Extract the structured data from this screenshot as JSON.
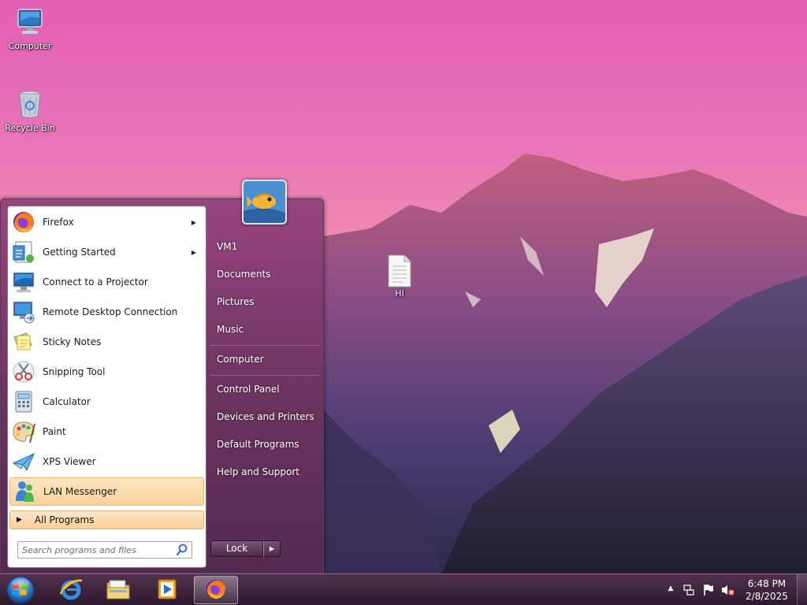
{
  "desktop": {
    "icons": [
      {
        "label": "Computer",
        "icon": "computer-icon"
      },
      {
        "label": "Recycle Bin",
        "icon": "recycle-bin-icon"
      },
      {
        "label": "HI",
        "icon": "text-file-icon"
      }
    ]
  },
  "start_menu": {
    "programs": [
      {
        "label": "Firefox",
        "icon": "firefox-icon",
        "has_submenu": true
      },
      {
        "label": "Getting Started",
        "icon": "getting-started-icon",
        "has_submenu": true
      },
      {
        "label": "Connect to a Projector",
        "icon": "projector-icon",
        "has_submenu": false
      },
      {
        "label": "Remote Desktop Connection",
        "icon": "remote-desktop-icon",
        "has_submenu": false
      },
      {
        "label": "Sticky Notes",
        "icon": "sticky-notes-icon",
        "has_submenu": false
      },
      {
        "label": "Snipping Tool",
        "icon": "scissors-icon",
        "has_submenu": false
      },
      {
        "label": "Calculator",
        "icon": "calculator-icon",
        "has_submenu": false
      },
      {
        "label": "Paint",
        "icon": "paint-palette-icon",
        "has_submenu": false
      },
      {
        "label": "XPS Viewer",
        "icon": "xps-viewer-icon",
        "has_submenu": false
      },
      {
        "label": "LAN Messenger",
        "icon": "lan-messenger-icon",
        "has_submenu": false,
        "highlighted": true
      }
    ],
    "all_programs_label": "All Programs",
    "search_placeholder": "Search programs and files",
    "places": [
      {
        "label": "VM1"
      },
      {
        "label": "Documents"
      },
      {
        "label": "Pictures"
      },
      {
        "label": "Music"
      },
      {
        "label": "Computer"
      },
      {
        "label": "Control Panel"
      },
      {
        "label": "Devices and Printers"
      },
      {
        "label": "Default Programs"
      },
      {
        "label": "Help and Support"
      }
    ],
    "lock_label": "Lock"
  },
  "taskbar": {
    "pinned": [
      {
        "icon": "internet-explorer-icon"
      },
      {
        "icon": "file-explorer-icon"
      },
      {
        "icon": "media-player-icon"
      },
      {
        "icon": "firefox-icon",
        "active": true
      }
    ],
    "clock": {
      "time": "6:48 PM",
      "date": "2/8/2025"
    }
  },
  "colors": {
    "highlight": "#fbd39c",
    "menu_bg": "#5f285a",
    "wallpaper_top": "#e35fb5"
  }
}
